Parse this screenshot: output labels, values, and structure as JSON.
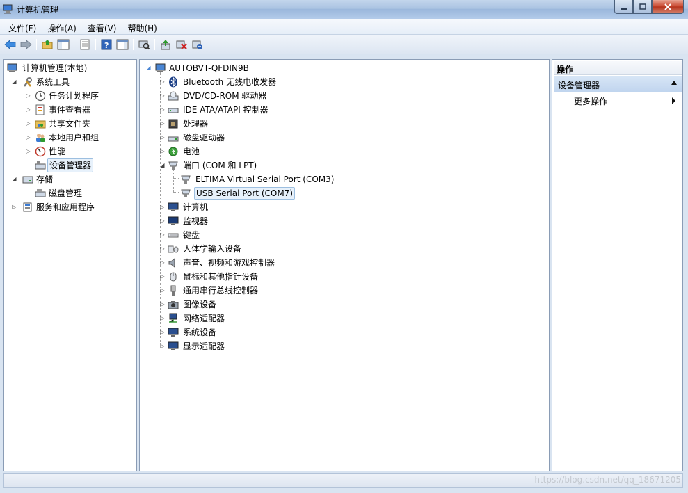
{
  "window": {
    "title": "计算机管理",
    "buttons": {
      "minimize": "—",
      "maximize": "□",
      "close": "✕"
    }
  },
  "menu": [
    "文件(F)",
    "操作(A)",
    "查看(V)",
    "帮助(H)"
  ],
  "toolbar": {
    "icons": [
      "back-arrow-icon",
      "forward-arrow-icon",
      "up-folder-icon",
      "show-hide-tree-icon",
      "export-list-icon",
      "help-icon",
      "show-hide-action-pane-icon",
      "scan-hardware-icon",
      "update-driver-icon",
      "disable-device-icon",
      "uninstall-device-icon"
    ]
  },
  "left_tree": {
    "root": "计算机管理(本地)",
    "system_tools": "系统工具",
    "task_scheduler": "任务计划程序",
    "event_viewer": "事件查看器",
    "shared_folders": "共享文件夹",
    "local_users": "本地用户和组",
    "performance": "性能",
    "device_manager": "设备管理器",
    "storage": "存储",
    "disk_management": "磁盘管理",
    "services_apps": "服务和应用程序"
  },
  "device_tree": {
    "computer": "AUTOBVT-QFDIN9B",
    "bluetooth": "Bluetooth 无线电收发器",
    "dvd": "DVD/CD-ROM 驱动器",
    "ide": "IDE ATA/ATAPI 控制器",
    "processor": "处理器",
    "disk": "磁盘驱动器",
    "battery": "电池",
    "ports": "端口 (COM 和 LPT)",
    "port_eltima": "ELTIMA Virtual Serial Port (COM3)",
    "port_usb": "USB Serial Port (COM7)",
    "computer_cat": "计算机",
    "monitors": "监视器",
    "keyboard": "键盘",
    "hid": "人体学输入设备",
    "sound": "声音、视频和游戏控制器",
    "mouse": "鼠标和其他指针设备",
    "usb": "通用串行总线控制器",
    "imaging": "图像设备",
    "network": "网络适配器",
    "system": "系统设备",
    "display": "显示适配器"
  },
  "actions": {
    "header": "操作",
    "section": "设备管理器",
    "more": "更多操作"
  },
  "watermark": "https://blog.csdn.net/qq_18671205",
  "colors": {
    "title_bar": "#aac3e2",
    "selection": "#e7f1fb",
    "action_section": "#c7daf1"
  }
}
